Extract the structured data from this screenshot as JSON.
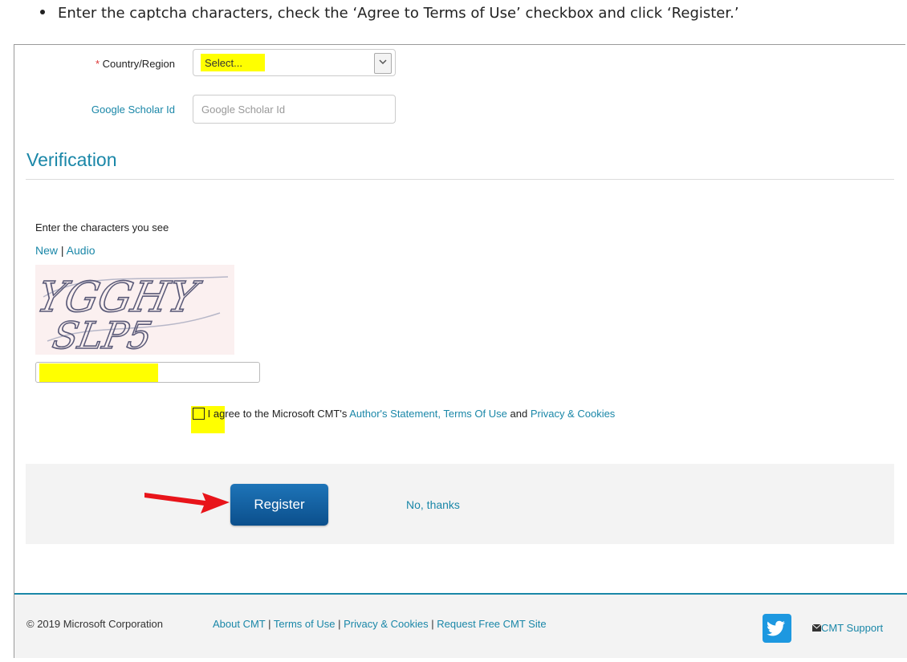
{
  "instruction": "Enter the captcha characters, check the ‘Agree to Terms of Use’ checkbox and click ‘Register.’",
  "form": {
    "country_required_mark": "*",
    "country_label": "Country/Region",
    "country_value": "Select...",
    "scholar_label": "Google Scholar Id",
    "scholar_placeholder": "Google Scholar Id"
  },
  "verification": {
    "title": "Verification",
    "captcha_label": "Enter the characters you see",
    "new_link": "New",
    "separator": "|",
    "audio_link": "Audio",
    "captcha_text_line1": "YGGHY",
    "captcha_text_line2": "SLP5"
  },
  "agree": {
    "prefix": "I agree to the Microsoft CMT's",
    "authors_statement": "Author's Statement,",
    "terms": "Terms Of Use",
    "and": "and",
    "privacy": "Privacy & Cookies"
  },
  "actions": {
    "register": "Register",
    "no_thanks": "No, thanks"
  },
  "footer": {
    "copyright": "© 2019 Microsoft Corporation",
    "about": "About CMT",
    "terms": "Terms of Use",
    "privacy": "Privacy & Cookies",
    "request": "Request Free CMT Site",
    "support": "CMT Support",
    "sep": "|"
  },
  "colors": {
    "accent": "#1a87a8",
    "highlight": "#ffff00",
    "button": "#0b5fa5",
    "arrow": "#e8141a",
    "twitter": "#1d98e0"
  },
  "icons": [
    "chevron-down-icon",
    "arrow-icon",
    "twitter-icon",
    "envelope-icon"
  ]
}
